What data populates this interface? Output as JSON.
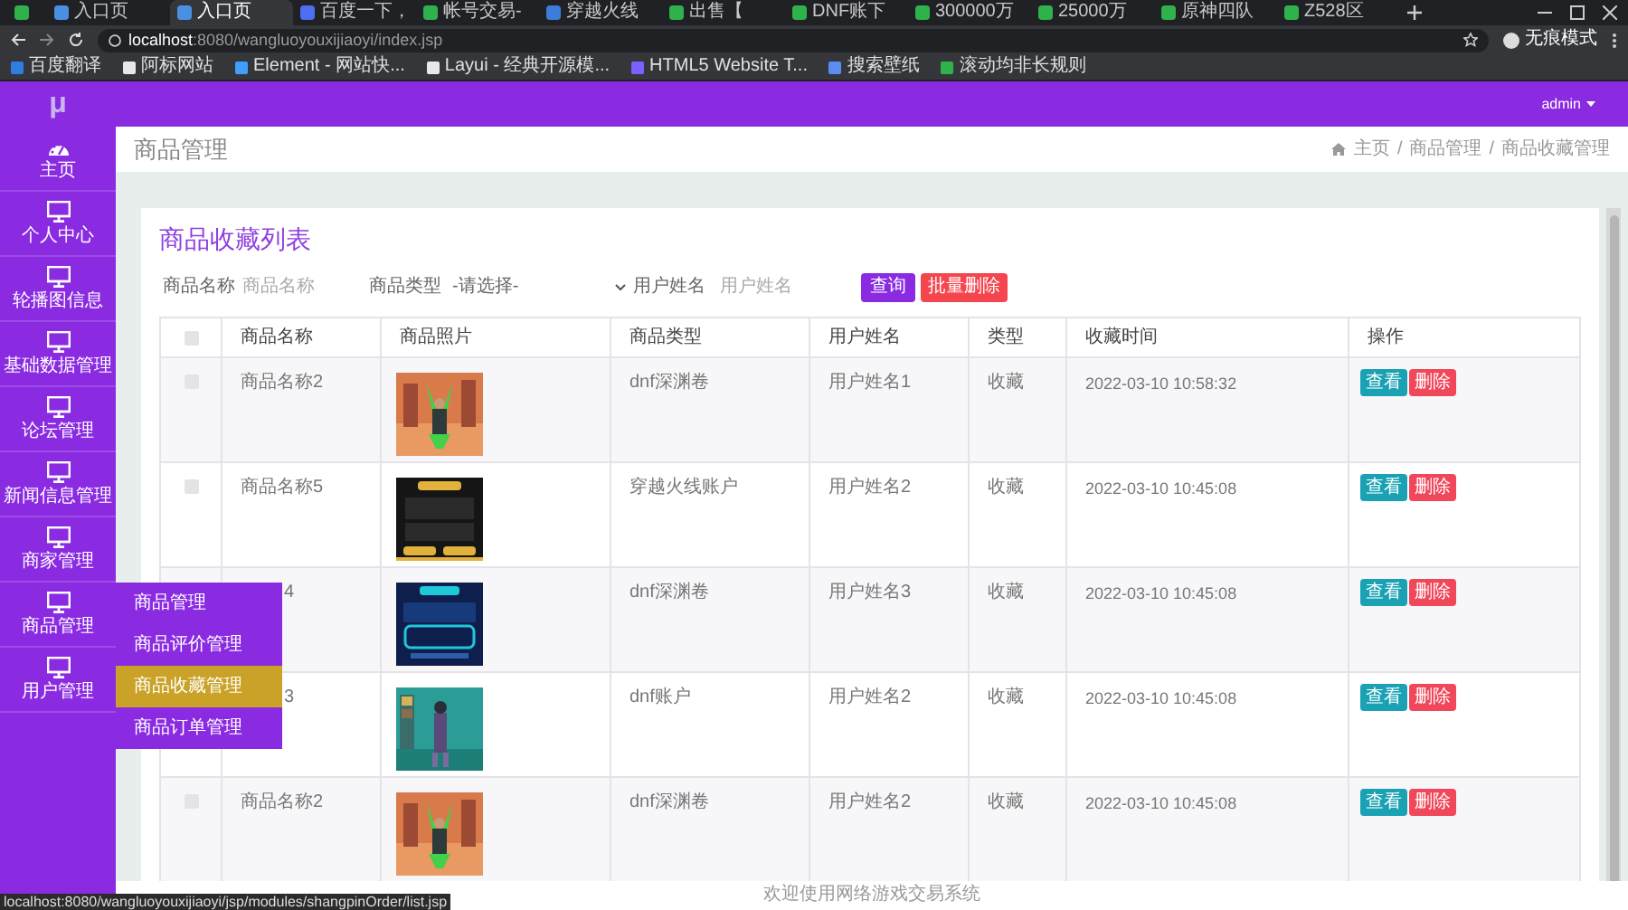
{
  "browser": {
    "tabs": [
      {
        "selected": false
      },
      {
        "title": "入口页",
        "selected": false
      },
      {
        "title": "入口页",
        "selected": true
      },
      {
        "title": "百度一下，",
        "selected": false
      },
      {
        "title": "帐号交易-",
        "selected": false
      },
      {
        "title": "穿越火线",
        "selected": false
      },
      {
        "title": "出售【",
        "selected": false
      },
      {
        "title": "DNF账下",
        "selected": false
      },
      {
        "title": "300000万",
        "selected": false
      },
      {
        "title": "25000万",
        "selected": false
      },
      {
        "title": "原神四队",
        "selected": false
      },
      {
        "title": "Z528区",
        "selected": false
      }
    ],
    "url_host": "localhost",
    "url_rest": ":8080/wangluoyouxijiaoyi/index.jsp",
    "profile": "无痕模式",
    "bookmarks": [
      "百度翻译",
      "阿标网站",
      "Element - 网站快...",
      "Layui - 经典开源模...",
      "HTML5 Website T...",
      "搜索壁纸",
      "滚动均非长规则"
    ]
  },
  "app": {
    "logo": "μ",
    "user": "admin",
    "sidebar": [
      {
        "label": "主页",
        "kind": "dashboard"
      },
      {
        "label": "个人中心",
        "kind": "monitor"
      },
      {
        "label": "轮播图信息",
        "kind": "monitor"
      },
      {
        "label": "基础数据管理",
        "kind": "monitor"
      },
      {
        "label": "论坛管理",
        "kind": "monitor"
      },
      {
        "label": "新闻信息管理",
        "kind": "monitor"
      },
      {
        "label": "商家管理",
        "kind": "monitor"
      },
      {
        "label": "商品管理",
        "kind": "monitor"
      },
      {
        "label": "用户管理",
        "kind": "monitor"
      }
    ],
    "submenu": [
      {
        "label": "商品管理",
        "selected": false
      },
      {
        "label": "商品评价管理",
        "selected": false
      },
      {
        "label": "商品收藏管理",
        "selected": true
      },
      {
        "label": "商品订单管理",
        "selected": false
      }
    ],
    "page_title": "商品管理",
    "breadcrumb": [
      "主页",
      "商品管理",
      "商品收藏管理"
    ],
    "breadcrumb_separators": [
      "/",
      "/"
    ],
    "card_title": "商品收藏列表",
    "filters": {
      "name_label": "商品名称",
      "name_placeholder": "商品名称",
      "type_label": "商品类型",
      "type_value": "-请选择-",
      "user_label": "用户姓名",
      "user_placeholder": "用户姓名",
      "search_button": "查询",
      "delete_button": "批量删除"
    },
    "table": {
      "header_checked": false,
      "columns": [
        "商品名称",
        "商品照片",
        "商品类型",
        "用户姓名",
        "类型",
        "收藏时间",
        "操作"
      ],
      "rows": [
        {
          "checked": false,
          "name": "商品名称2",
          "photo": {
            "kind": "picture"
          },
          "product_type": "dnf深渊卷",
          "user": "用户姓名1",
          "type": "收藏",
          "time": "2022-03-10 10:58:32",
          "actions": [
            "查看",
            "删除"
          ]
        },
        {
          "checked": false,
          "name": "商品名称5",
          "photo": {
            "kind": "picture"
          },
          "product_type": "穿越火线账户",
          "user": "用户姓名2",
          "type": "收藏",
          "time": "2022-03-10 10:45:08",
          "actions": [
            "查看",
            "删除"
          ]
        },
        {
          "name": "4",
          "covered": true,
          "photo": {
            "kind": "picture"
          },
          "product_type": "dnf深渊卷",
          "user": "用户姓名3",
          "type": "收藏",
          "time": "2022-03-10 10:45:08",
          "actions": [
            "查看",
            "删除"
          ]
        },
        {
          "name": "3",
          "covered": true,
          "photo": {
            "kind": "picture"
          },
          "product_type": "dnf账户",
          "user": "用户姓名2",
          "type": "收藏",
          "time": "2022-03-10 10:45:08",
          "actions": [
            "查看",
            "删除"
          ]
        },
        {
          "checked": false,
          "name": "商品名称2",
          "photo": {
            "kind": "picture"
          },
          "product_type": "dnf深渊卷",
          "user": "用户姓名2",
          "type": "收藏",
          "time": "2022-03-10 10:45:08",
          "actions": [
            "查看",
            "删除"
          ]
        }
      ]
    },
    "footer": "欢迎使用网络游戏交易系统"
  },
  "status_url": "localhost:8080/wangluoyouxijiaoyi/jsp/modules/shangpinOrder/list.jsp"
}
